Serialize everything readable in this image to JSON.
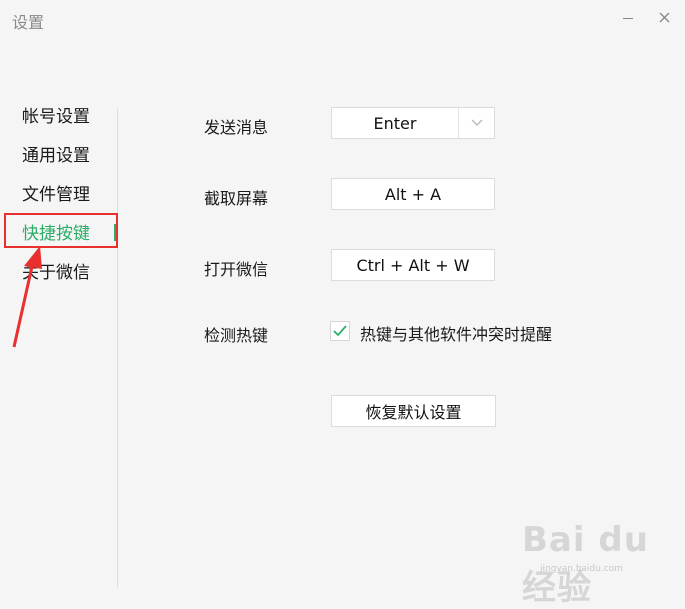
{
  "window": {
    "title": "设置"
  },
  "sidebar": {
    "items": [
      {
        "label": "帐号设置"
      },
      {
        "label": "通用设置"
      },
      {
        "label": "文件管理"
      },
      {
        "label": "快捷按键"
      },
      {
        "label": "关于微信"
      }
    ],
    "active_index": 3
  },
  "shortcuts": [
    {
      "label": "发送消息",
      "value": "Enter"
    },
    {
      "label": "截取屏幕",
      "value": "Alt + A"
    },
    {
      "label": "打开微信",
      "value": "Ctrl + Alt + W"
    }
  ],
  "hotkey_detect": {
    "label": "检测热键",
    "checkbox_label": "热键与其他软件冲突时提醒",
    "checked": true
  },
  "reset_button": {
    "label": "恢复默认设置"
  },
  "watermark": {
    "brand": "Bai du 经验",
    "url": "jingyan.baidu.com"
  },
  "colors": {
    "accent": "#2aae67",
    "annotation": "#e8302f"
  },
  "icons": [
    "minimize-icon",
    "close-icon",
    "chevron-down-icon",
    "check-icon"
  ]
}
